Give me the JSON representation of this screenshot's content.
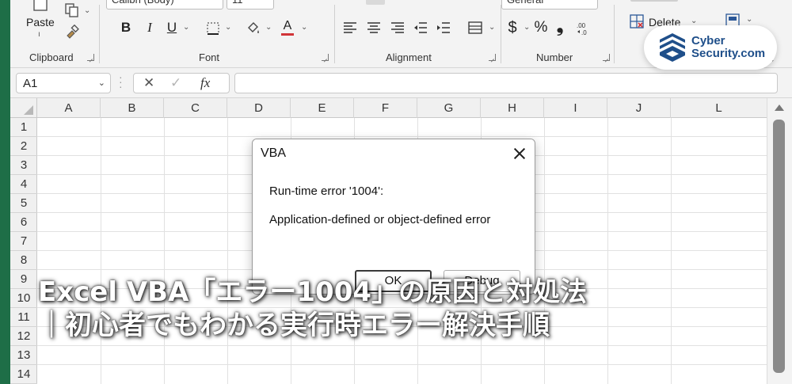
{
  "ribbon": {
    "clipboard": {
      "paste_label": "Paste",
      "group_label": "Clipboard"
    },
    "font": {
      "font_name": "Calibri (Body)",
      "font_size": "11",
      "group_label": "Font",
      "bold": "B",
      "italic": "I",
      "underline": "U"
    },
    "alignment": {
      "group_label": "Alignment"
    },
    "number": {
      "format": "General",
      "currency": "$",
      "percent": "%",
      "comma": "❟",
      "group_label": "Number"
    },
    "cells": {
      "delete_label": "Delete"
    }
  },
  "formula_bar": {
    "name_box": "A1",
    "fx": "fx",
    "cancel": "✕",
    "enter": "✓",
    "value": ""
  },
  "grid": {
    "columns": [
      "A",
      "B",
      "C",
      "D",
      "E",
      "F",
      "G",
      "H",
      "I",
      "J",
      "L"
    ],
    "rows": [
      "1",
      "2",
      "3",
      "4",
      "5",
      "6",
      "7",
      "8",
      "9",
      "10",
      "11",
      "12",
      "13",
      "14"
    ]
  },
  "dialog": {
    "title": "VBA",
    "error_code": "Run-time error '1004':",
    "error_message": "Application-defined or object-defined error",
    "ok_label": "OK",
    "debug_label": "Debug"
  },
  "headline": {
    "line1": "Excel VBA「エラー1004」の原因と対処法",
    "line2": "｜初心者でもわかる実行時エラー解決手順"
  },
  "logo": {
    "line1": "Cyber",
    "line2": "Security.com"
  },
  "colors": {
    "excel_green": "#1e6e47",
    "logo_blue": "#1f4f8a",
    "font_color_red": "#d13438"
  }
}
